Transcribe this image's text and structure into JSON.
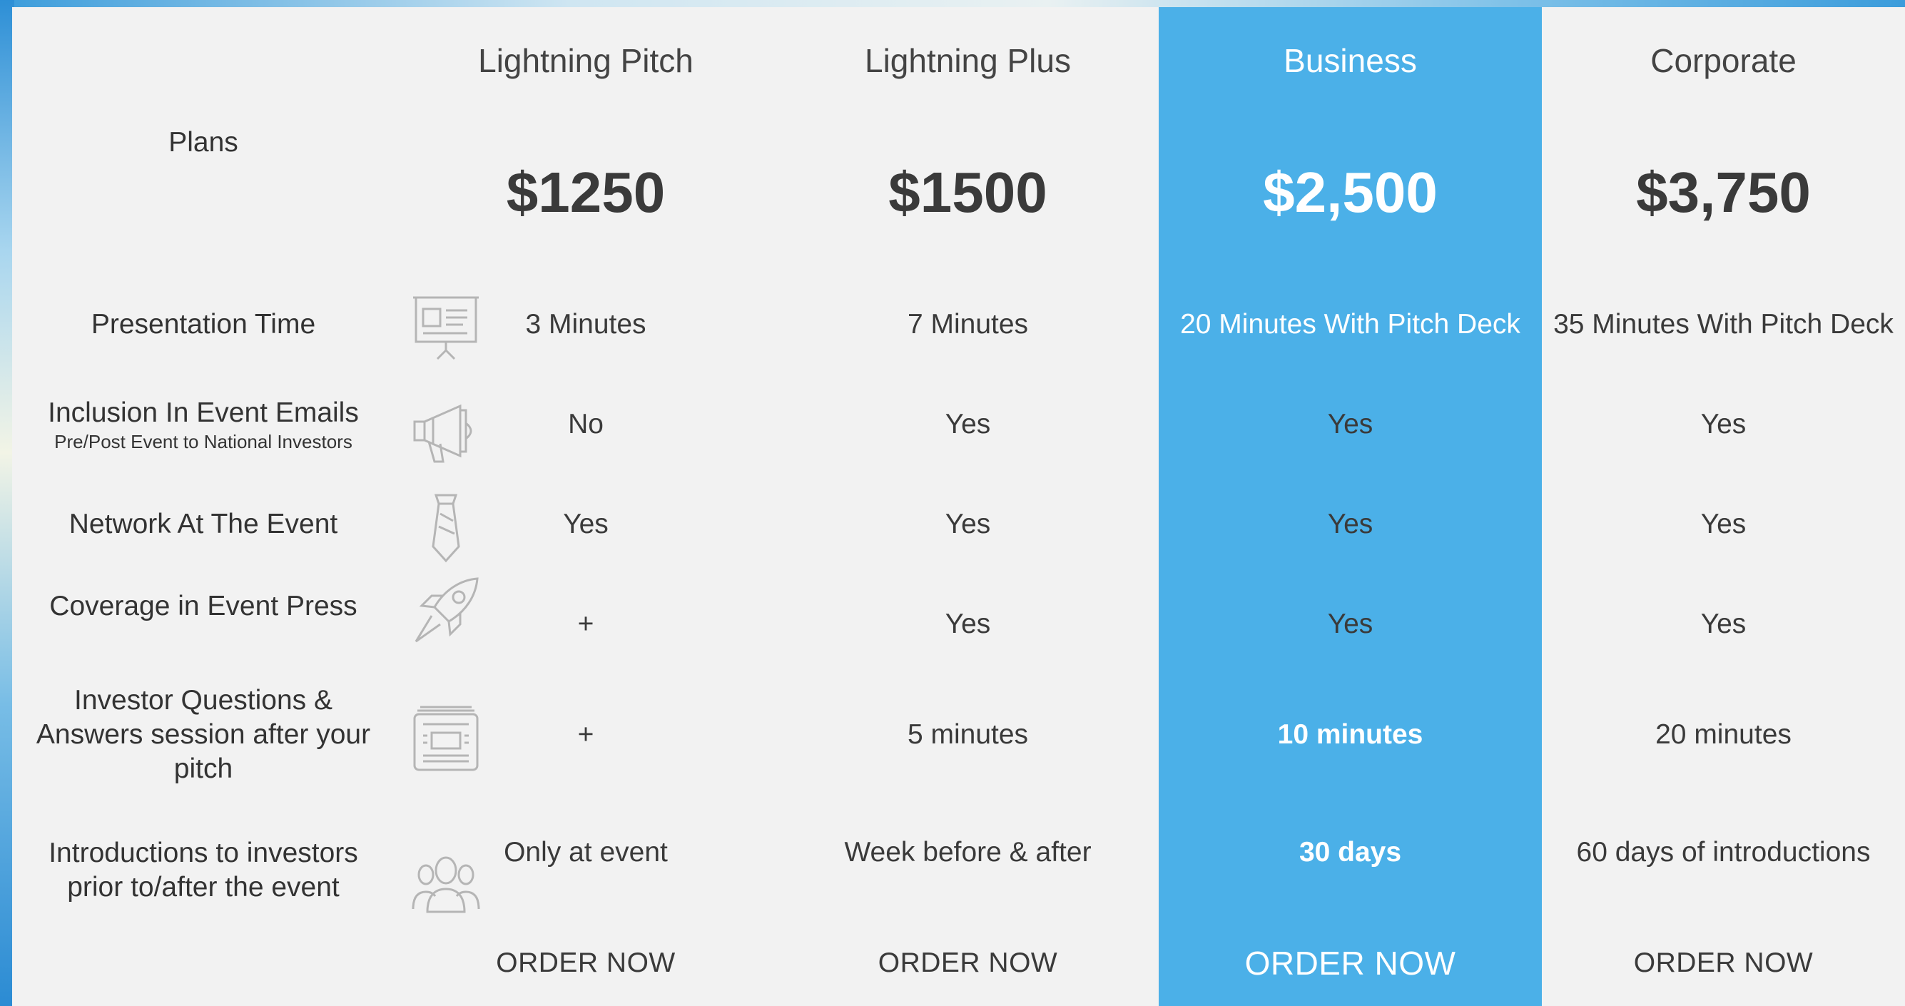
{
  "header_label": "Plans",
  "plans": [
    {
      "name": "Lightning Pitch",
      "price": "$1250",
      "order_label": "ORDER NOW"
    },
    {
      "name": "Lightning Plus",
      "price": "$1500",
      "order_label": "ORDER NOW"
    },
    {
      "name": "Business",
      "price": "$2,500",
      "order_label": "ORDER NOW"
    },
    {
      "name": "Corporate",
      "price": "$3,750",
      "order_label": "ORDER NOW"
    }
  ],
  "features": [
    {
      "label": "Presentation Time",
      "icon": "presentation-board-icon",
      "values": [
        "3 Minutes",
        "7 Minutes",
        "20 Minutes With Pitch Deck",
        "35 Minutes With Pitch Deck"
      ]
    },
    {
      "label": "Inclusion In Event Emails",
      "sublabel": "Pre/Post Event to National Investors",
      "icon": "megaphone-icon",
      "values": [
        "No",
        "Yes",
        "Yes",
        "Yes"
      ]
    },
    {
      "label": "Network At The Event",
      "icon": "necktie-icon",
      "values": [
        "Yes",
        "Yes",
        "Yes",
        "Yes"
      ]
    },
    {
      "label": "Coverage in Event Press",
      "icon": "rocket-icon",
      "values": [
        "+",
        "Yes",
        "Yes",
        "Yes"
      ]
    },
    {
      "label_lines": [
        "Investor Questions &",
        "Answers session after your",
        "pitch"
      ],
      "icon": "newspaper-icon",
      "values": [
        "+",
        "5 minutes",
        "10 minutes",
        "20 minutes"
      ]
    },
    {
      "label_lines": [
        "Introductions to investors",
        "prior to/after the event"
      ],
      "icon": "people-group-icon",
      "values": [
        "Only at event",
        "Week before & after",
        "30 days",
        "60 days of introductions"
      ]
    }
  ],
  "colors": {
    "panel_bg": "#f2f2f2",
    "business_accent": "#4bb0e8",
    "text": "#3a3a3a",
    "icon_stroke": "#b5b5b5"
  }
}
